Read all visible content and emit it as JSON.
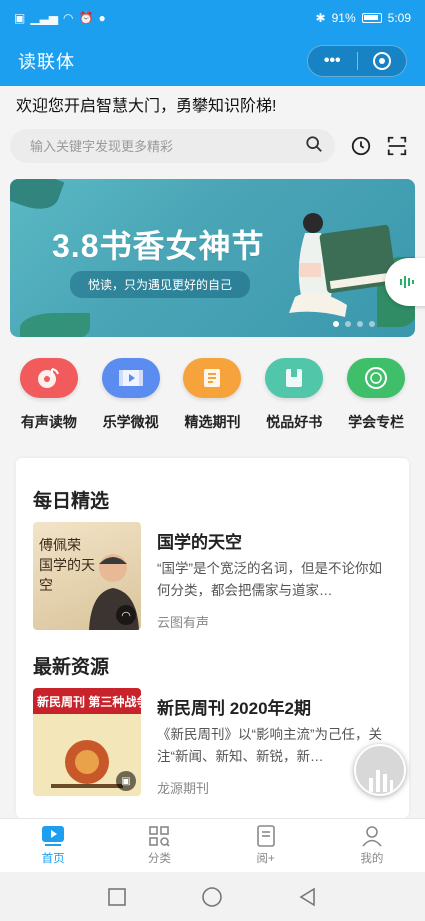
{
  "status": {
    "battery_pct": "91%",
    "time": "5:09"
  },
  "app": {
    "title": "读联体"
  },
  "welcome": "欢迎您开启智慧大门，勇攀知识阶梯!",
  "search": {
    "placeholder": "输入关键字发现更多精彩"
  },
  "banner": {
    "title": "3.8书香女神节",
    "subtitle": "悦读，只为遇见更好的自己",
    "active_dot": 0
  },
  "categories": [
    {
      "label": "有声读物",
      "icon": "music-disc-icon",
      "color": "#f25b5b"
    },
    {
      "label": "乐学微视",
      "icon": "film-icon",
      "color": "#5b8df0"
    },
    {
      "label": "精选期刊",
      "icon": "journal-icon",
      "color": "#f5a33a"
    },
    {
      "label": "悦品好书",
      "icon": "book-icon",
      "color": "#52c6a8"
    },
    {
      "label": "学会专栏",
      "icon": "seal-icon",
      "color": "#3fbf6a"
    }
  ],
  "daily": {
    "title": "每日精选",
    "item": {
      "title": "国学的天空",
      "desc": "“国学”是个宽泛的名词，但是不论你如何分类，都会把儒家与道家…",
      "source": "云图有声",
      "cover_text": "傅佩荣 国学的天空"
    }
  },
  "latest": {
    "title": "最新资源",
    "item": {
      "title": "新民周刊 2020年2期",
      "desc": "《新民周刊》以“影响主流”为己任，关注“新闻、新知、新锐，新…",
      "source": "龙源期刊",
      "cover_text": "新民周刊 第三种战争"
    }
  },
  "tabs": [
    {
      "label": "首页",
      "icon": "home-play-icon",
      "active": true
    },
    {
      "label": "分类",
      "icon": "category-grid-icon",
      "active": false
    },
    {
      "label": "阅+",
      "icon": "reading-icon",
      "active": false
    },
    {
      "label": "我的",
      "icon": "user-icon",
      "active": false
    }
  ],
  "colors": {
    "primary": "#1d9ff0",
    "banner": "#4aa6b6"
  }
}
